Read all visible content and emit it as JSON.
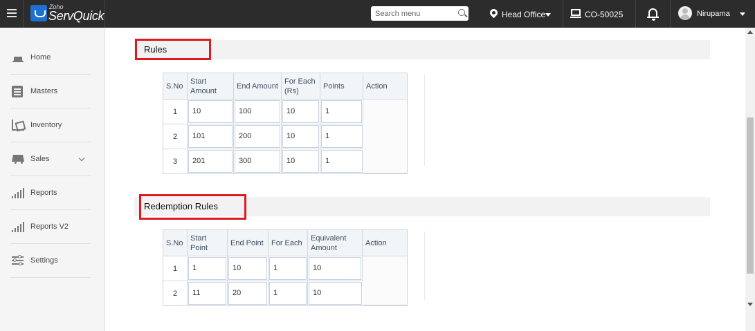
{
  "app": {
    "brand_prefix": "Zoho",
    "brand_name": "ServQuick"
  },
  "header": {
    "search_placeholder": "Search menu",
    "branch": "Head Office",
    "terminal": "CO-50025",
    "user_name": "Nirupama"
  },
  "sidebar": {
    "items": [
      {
        "label": "Home",
        "icon": "home-icon"
      },
      {
        "label": "Masters",
        "icon": "masters-icon"
      },
      {
        "label": "Inventory",
        "icon": "inventory-icon"
      },
      {
        "label": "Sales",
        "icon": "cart-icon"
      },
      {
        "label": "Reports",
        "icon": "bar-chart-icon"
      },
      {
        "label": "Reports V2",
        "icon": "bar-chart-icon"
      },
      {
        "label": "Settings",
        "icon": "settings-sliders-icon"
      }
    ]
  },
  "rules": {
    "title": "Rules",
    "headers": [
      "S.No",
      "Start Amount",
      "End Amount",
      "For Each (Rs)",
      "Points",
      "Action"
    ],
    "rows": [
      {
        "sno": "1",
        "start": "10",
        "end": "100",
        "each": "10",
        "points": "1"
      },
      {
        "sno": "2",
        "start": "101",
        "end": "200",
        "each": "10",
        "points": "1"
      },
      {
        "sno": "3",
        "start": "201",
        "end": "300",
        "each": "10",
        "points": "1"
      }
    ]
  },
  "redemption": {
    "title": "Redemption Rules",
    "headers": [
      "S.No",
      "Start Point",
      "End Point",
      "For Each",
      "Equivalent Amount",
      "Action"
    ],
    "rows": [
      {
        "sno": "1",
        "start": "1",
        "end": "10",
        "each": "1",
        "amount": "10"
      },
      {
        "sno": "2",
        "start": "11",
        "end": "20",
        "each": "1",
        "amount": "10"
      }
    ]
  },
  "colors": {
    "topbar": "#2c2c2c",
    "highlight": "#e0191f",
    "brand_blue": "#1e6fd0"
  }
}
